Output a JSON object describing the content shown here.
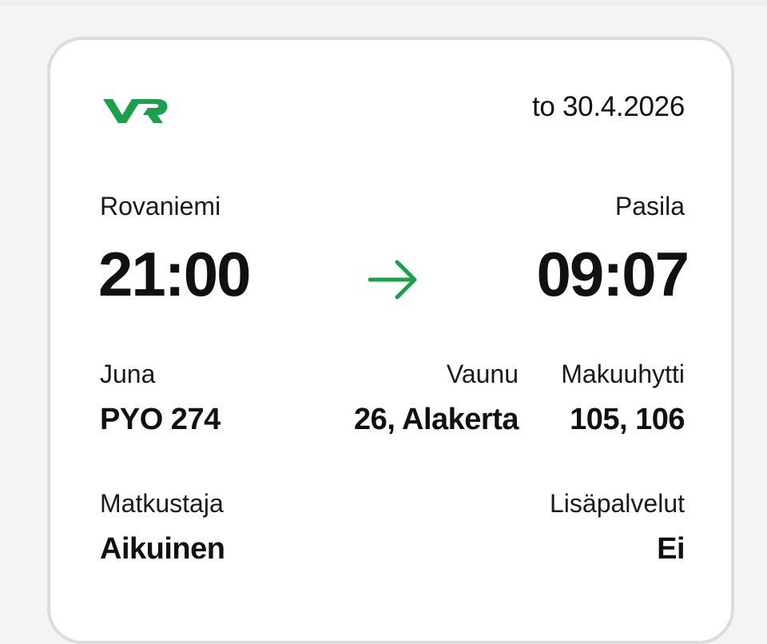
{
  "brand": {
    "logo_text": "VR",
    "accent_color": "#1aa04a"
  },
  "ticket": {
    "date": "to 30.4.2026",
    "departure": {
      "station": "Rovaniemi",
      "time": "21:00"
    },
    "arrival": {
      "station": "Pasila",
      "time": "09:07"
    },
    "arrow_icon": "arrow-right-icon",
    "train": {
      "label": "Juna",
      "value": "PYO 274"
    },
    "carriage": {
      "label": "Vaunu",
      "value": "26, Alakerta"
    },
    "cabin": {
      "label": "Makuuhytti",
      "value": "105, 106"
    },
    "passenger": {
      "label": "Matkustaja",
      "value": "Aikuinen"
    },
    "extras": {
      "label": "Lisäpalvelut",
      "value": "Ei"
    }
  }
}
